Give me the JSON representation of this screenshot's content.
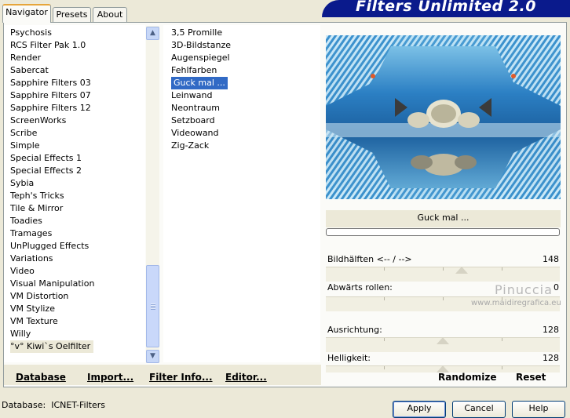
{
  "tabs": [
    {
      "label": "Navigator",
      "active": true
    },
    {
      "label": "Presets",
      "active": false
    },
    {
      "label": "About",
      "active": false
    }
  ],
  "banner": {
    "title": "Filters Unlimited 2.0",
    "color": "#0a1a8c"
  },
  "categories": {
    "items": [
      "Psychosis",
      "RCS Filter Pak 1.0",
      "Render",
      "Sabercat",
      "Sapphire Filters 03",
      "Sapphire Filters 07",
      "Sapphire Filters 12",
      "ScreenWorks",
      "Scribe",
      "Simple",
      "Special Effects 1",
      "Special Effects 2",
      "Sybia",
      "Teph's Tricks",
      "Tile & Mirror",
      "Toadies",
      "Tramages",
      "UnPlugged Effects",
      "Variations",
      "Video",
      "Visual Manipulation",
      "VM Distortion",
      "VM Stylize",
      "VM Texture",
      "Willy",
      "°v° Kiwi`s Oelfilter"
    ],
    "selected": "°v° Kiwi`s Oelfilter"
  },
  "filters": {
    "items": [
      "3,5 Promille",
      "3D-Bildstanze",
      "Augenspiegel",
      "Fehlfarben",
      "Guck mal ...",
      "Leinwand",
      "Neontraum",
      "Setzboard",
      "Videowand",
      "Zig-Zack"
    ],
    "selected": "Guck mal ...",
    "selected_color": "#316ac5"
  },
  "preview": {
    "filter_name": "Guck mal ...",
    "dominant_color": "#2c80c4"
  },
  "parameters": [
    {
      "label": "Bildhälften <-- / -->",
      "value": "148",
      "level": 0.58
    },
    {
      "label": "Abwärts rollen:",
      "value": "0",
      "level": 0.0
    },
    {
      "label": "Ausrichtung:",
      "value": "128",
      "level": 0.5
    },
    {
      "label": "Helligkeit:",
      "value": "128",
      "level": 0.5
    }
  ],
  "watermark": {
    "line1": "Pinuccia",
    "line2": "www.maidiregrafica.eu"
  },
  "buttons": {
    "database": "Database",
    "import": "Import...",
    "filter_info": "Filter Info...",
    "editor": "Editor...",
    "randomize": "Randomize",
    "reset": "Reset",
    "apply": "Apply",
    "cancel": "Cancel",
    "help": "Help"
  },
  "status": {
    "database_label": "Database:",
    "database_value": "ICNET-Filters"
  },
  "icons": {
    "scroll_up": "chevron-up-icon",
    "scroll_down": "chevron-down-icon"
  }
}
